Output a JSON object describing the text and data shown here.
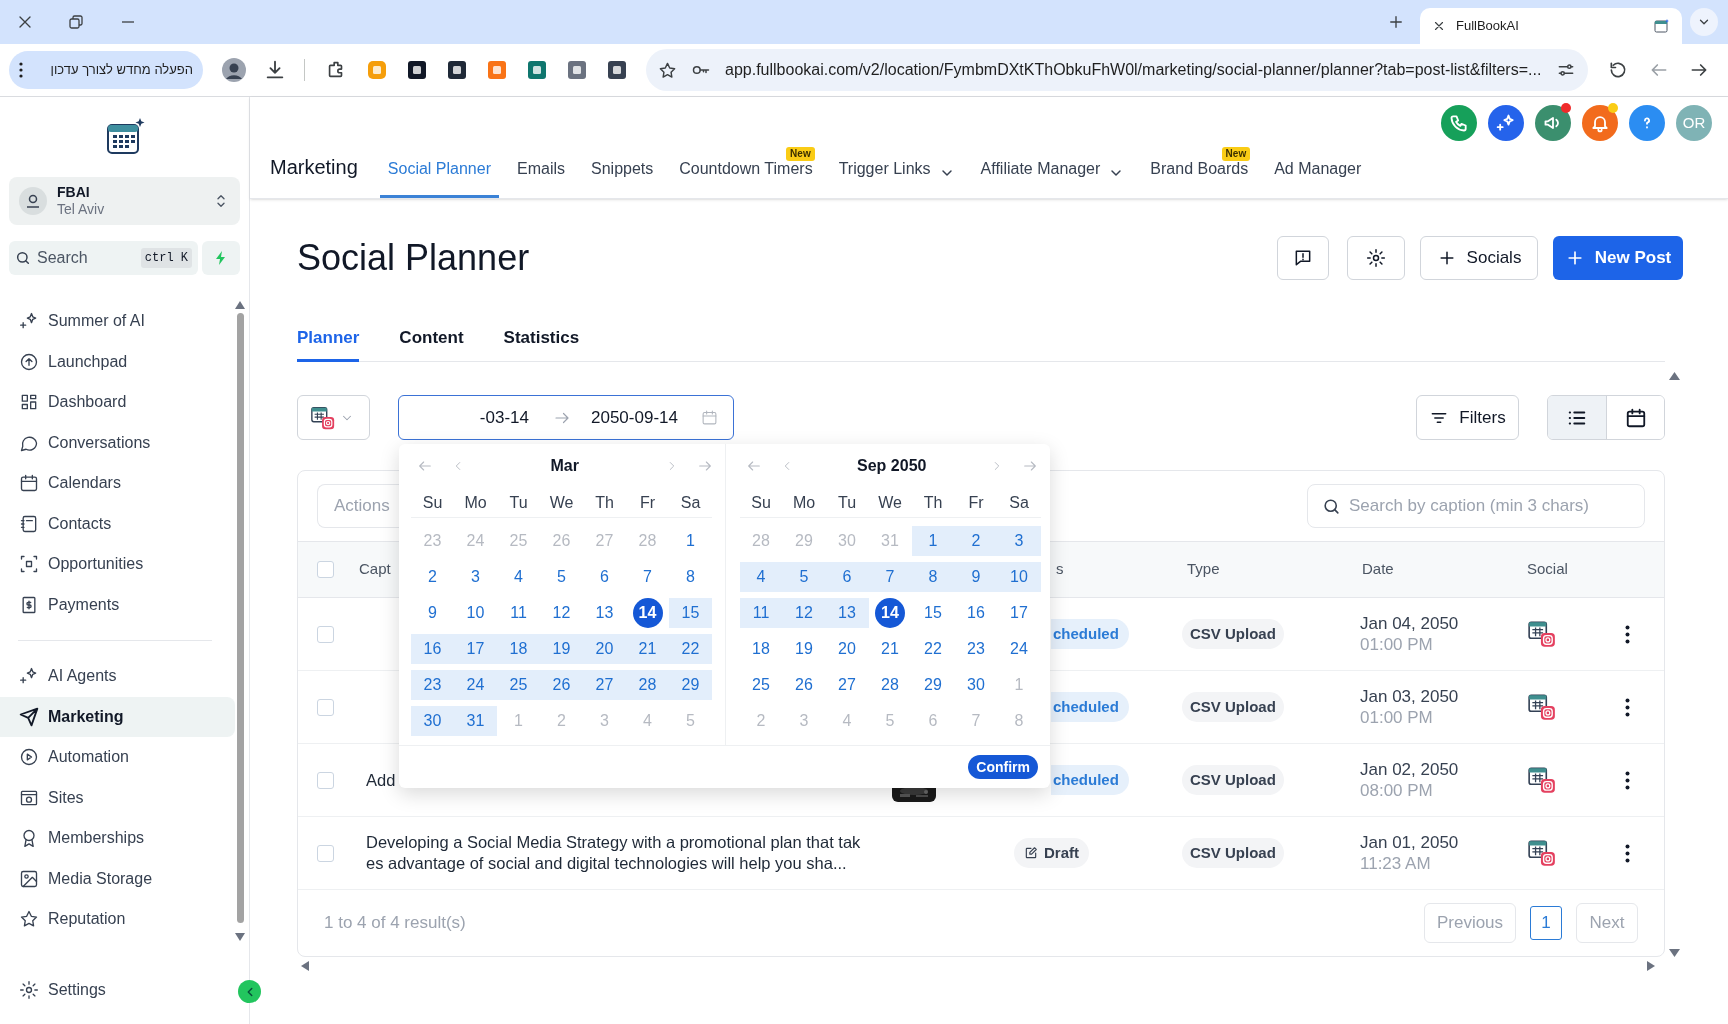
{
  "browser": {
    "tab_title": "FullBookAI",
    "update_button": "הפעלה מחדש לצורך עדכון",
    "url": "app.fullbookai.com/v2/location/FymbmDXtKThObkuFhW0l/marketing/social-planner/planner?tab=post-list&filters=..."
  },
  "sidebar": {
    "account": {
      "name": "FBAI",
      "location": "Tel Aviv"
    },
    "search": {
      "placeholder": "Search",
      "shortcut": "ctrl K"
    },
    "sections": [
      {
        "items": [
          {
            "label": "Summer of AI",
            "selected": false
          },
          {
            "label": "Launchpad",
            "selected": false
          },
          {
            "label": "Dashboard",
            "selected": false
          },
          {
            "label": "Conversations",
            "selected": false
          },
          {
            "label": "Calendars",
            "selected": false
          },
          {
            "label": "Contacts",
            "selected": false
          },
          {
            "label": "Opportunities",
            "selected": false
          },
          {
            "label": "Payments",
            "selected": false
          }
        ]
      },
      {
        "items": [
          {
            "label": "AI Agents",
            "selected": false
          },
          {
            "label": "Marketing",
            "selected": true
          },
          {
            "label": "Automation",
            "selected": false
          },
          {
            "label": "Sites",
            "selected": false
          },
          {
            "label": "Memberships",
            "selected": false
          },
          {
            "label": "Media Storage",
            "selected": false
          },
          {
            "label": "Reputation",
            "selected": false
          }
        ]
      }
    ],
    "settings": "Settings"
  },
  "header": {
    "title": "Marketing",
    "avatar": "OR",
    "nav": [
      {
        "label": "Social Planner",
        "selected": true,
        "dropdown": false
      },
      {
        "label": "Emails",
        "selected": false,
        "dropdown": false
      },
      {
        "label": "Snippets",
        "selected": false,
        "dropdown": false
      },
      {
        "label": "Countdown Timers",
        "selected": false,
        "dropdown": false,
        "badge": "New"
      },
      {
        "label": "Trigger Links",
        "selected": false,
        "dropdown": true
      },
      {
        "label": "Affiliate Manager",
        "selected": false,
        "dropdown": true
      },
      {
        "label": "Brand Boards",
        "selected": false,
        "dropdown": false,
        "badge": "New"
      },
      {
        "label": "Ad Manager",
        "selected": false,
        "dropdown": false
      }
    ]
  },
  "page": {
    "title": "Social Planner",
    "socials_button": "Socials",
    "new_post_button": "New Post",
    "tabs": [
      {
        "label": "Planner",
        "selected": true
      },
      {
        "label": "Content",
        "selected": false
      },
      {
        "label": "Statistics",
        "selected": false
      }
    ]
  },
  "filters": {
    "start_date": "-03-14",
    "end_date": "2050-09-14",
    "filters_button": "Filters",
    "views": [
      {
        "selected": true
      },
      {
        "selected": false
      }
    ]
  },
  "date_picker": {
    "confirm": "Confirm",
    "months": [
      {
        "title": "Mar",
        "weekdays": [
          "Su",
          "Mo",
          "Tu",
          "We",
          "Th",
          "Fr",
          "Sa"
        ],
        "weeks": [
          [
            {
              "t": "23",
              "muted": true,
              "in_range": false,
              "selected": false
            },
            {
              "t": "24",
              "muted": true,
              "in_range": false,
              "selected": false
            },
            {
              "t": "25",
              "muted": true,
              "in_range": false,
              "selected": false
            },
            {
              "t": "26",
              "muted": true,
              "in_range": false,
              "selected": false
            },
            {
              "t": "27",
              "muted": true,
              "in_range": false,
              "selected": false
            },
            {
              "t": "28",
              "muted": true,
              "in_range": false,
              "selected": false
            },
            {
              "t": "1",
              "muted": false,
              "in_range": false,
              "selected": false
            }
          ],
          [
            {
              "t": "2",
              "muted": false,
              "in_range": false,
              "selected": false
            },
            {
              "t": "3",
              "muted": false,
              "in_range": false,
              "selected": false
            },
            {
              "t": "4",
              "muted": false,
              "in_range": false,
              "selected": false
            },
            {
              "t": "5",
              "muted": false,
              "in_range": false,
              "selected": false
            },
            {
              "t": "6",
              "muted": false,
              "in_range": false,
              "selected": false
            },
            {
              "t": "7",
              "muted": false,
              "in_range": false,
              "selected": false
            },
            {
              "t": "8",
              "muted": false,
              "in_range": false,
              "selected": false
            }
          ],
          [
            {
              "t": "9",
              "muted": false,
              "in_range": false,
              "selected": false
            },
            {
              "t": "10",
              "muted": false,
              "in_range": false,
              "selected": false
            },
            {
              "t": "11",
              "muted": false,
              "in_range": false,
              "selected": false
            },
            {
              "t": "12",
              "muted": false,
              "in_range": false,
              "selected": false
            },
            {
              "t": "13",
              "muted": false,
              "in_range": false,
              "selected": false
            },
            {
              "t": "14",
              "muted": false,
              "in_range": false,
              "selected": true
            },
            {
              "t": "15",
              "muted": false,
              "in_range": true,
              "selected": false
            }
          ],
          [
            {
              "t": "16",
              "muted": false,
              "in_range": true,
              "selected": false
            },
            {
              "t": "17",
              "muted": false,
              "in_range": true,
              "selected": false
            },
            {
              "t": "18",
              "muted": false,
              "in_range": true,
              "selected": false
            },
            {
              "t": "19",
              "muted": false,
              "in_range": true,
              "selected": false
            },
            {
              "t": "20",
              "muted": false,
              "in_range": true,
              "selected": false
            },
            {
              "t": "21",
              "muted": false,
              "in_range": true,
              "selected": false
            },
            {
              "t": "22",
              "muted": false,
              "in_range": true,
              "selected": false
            }
          ],
          [
            {
              "t": "23",
              "muted": false,
              "in_range": true,
              "selected": false
            },
            {
              "t": "24",
              "muted": false,
              "in_range": true,
              "selected": false
            },
            {
              "t": "25",
              "muted": false,
              "in_range": true,
              "selected": false
            },
            {
              "t": "26",
              "muted": false,
              "in_range": true,
              "selected": false
            },
            {
              "t": "27",
              "muted": false,
              "in_range": true,
              "selected": false
            },
            {
              "t": "28",
              "muted": false,
              "in_range": true,
              "selected": false
            },
            {
              "t": "29",
              "muted": false,
              "in_range": true,
              "selected": false
            }
          ],
          [
            {
              "t": "30",
              "muted": false,
              "in_range": true,
              "selected": false
            },
            {
              "t": "31",
              "muted": false,
              "in_range": true,
              "selected": false
            },
            {
              "t": "1",
              "muted": true,
              "in_range": false,
              "selected": false
            },
            {
              "t": "2",
              "muted": true,
              "in_range": false,
              "selected": false
            },
            {
              "t": "3",
              "muted": true,
              "in_range": false,
              "selected": false
            },
            {
              "t": "4",
              "muted": true,
              "in_range": false,
              "selected": false
            },
            {
              "t": "5",
              "muted": true,
              "in_range": false,
              "selected": false
            }
          ]
        ]
      },
      {
        "title": "Sep 2050",
        "weekdays": [
          "Su",
          "Mo",
          "Tu",
          "We",
          "Th",
          "Fr",
          "Sa"
        ],
        "weeks": [
          [
            {
              "t": "28",
              "muted": true,
              "in_range": false,
              "selected": false
            },
            {
              "t": "29",
              "muted": true,
              "in_range": false,
              "selected": false
            },
            {
              "t": "30",
              "muted": true,
              "in_range": false,
              "selected": false
            },
            {
              "t": "31",
              "muted": true,
              "in_range": false,
              "selected": false
            },
            {
              "t": "1",
              "muted": false,
              "in_range": true,
              "selected": false
            },
            {
              "t": "2",
              "muted": false,
              "in_range": true,
              "selected": false
            },
            {
              "t": "3",
              "muted": false,
              "in_range": true,
              "selected": false
            }
          ],
          [
            {
              "t": "4",
              "muted": false,
              "in_range": true,
              "selected": false
            },
            {
              "t": "5",
              "muted": false,
              "in_range": true,
              "selected": false
            },
            {
              "t": "6",
              "muted": false,
              "in_range": true,
              "selected": false
            },
            {
              "t": "7",
              "muted": false,
              "in_range": true,
              "selected": false
            },
            {
              "t": "8",
              "muted": false,
              "in_range": true,
              "selected": false
            },
            {
              "t": "9",
              "muted": false,
              "in_range": true,
              "selected": false
            },
            {
              "t": "10",
              "muted": false,
              "in_range": true,
              "selected": false
            }
          ],
          [
            {
              "t": "11",
              "muted": false,
              "in_range": true,
              "selected": false
            },
            {
              "t": "12",
              "muted": false,
              "in_range": true,
              "selected": false
            },
            {
              "t": "13",
              "muted": false,
              "in_range": true,
              "selected": false
            },
            {
              "t": "14",
              "muted": false,
              "in_range": false,
              "selected": true
            },
            {
              "t": "15",
              "muted": false,
              "in_range": false,
              "selected": false
            },
            {
              "t": "16",
              "muted": false,
              "in_range": false,
              "selected": false
            },
            {
              "t": "17",
              "muted": false,
              "in_range": false,
              "selected": false
            }
          ],
          [
            {
              "t": "18",
              "muted": false,
              "in_range": false,
              "selected": false
            },
            {
              "t": "19",
              "muted": false,
              "in_range": false,
              "selected": false
            },
            {
              "t": "20",
              "muted": false,
              "in_range": false,
              "selected": false
            },
            {
              "t": "21",
              "muted": false,
              "in_range": false,
              "selected": false
            },
            {
              "t": "22",
              "muted": false,
              "in_range": false,
              "selected": false
            },
            {
              "t": "23",
              "muted": false,
              "in_range": false,
              "selected": false
            },
            {
              "t": "24",
              "muted": false,
              "in_range": false,
              "selected": false
            }
          ],
          [
            {
              "t": "25",
              "muted": false,
              "in_range": false,
              "selected": false
            },
            {
              "t": "26",
              "muted": false,
              "in_range": false,
              "selected": false
            },
            {
              "t": "27",
              "muted": false,
              "in_range": false,
              "selected": false
            },
            {
              "t": "28",
              "muted": false,
              "in_range": false,
              "selected": false
            },
            {
              "t": "29",
              "muted": false,
              "in_range": false,
              "selected": false
            },
            {
              "t": "30",
              "muted": false,
              "in_range": false,
              "selected": false
            },
            {
              "t": "1",
              "muted": true,
              "in_range": false,
              "selected": false
            }
          ],
          [
            {
              "t": "2",
              "muted": true,
              "in_range": false,
              "selected": false
            },
            {
              "t": "3",
              "muted": true,
              "in_range": false,
              "selected": false
            },
            {
              "t": "4",
              "muted": true,
              "in_range": false,
              "selected": false
            },
            {
              "t": "5",
              "muted": true,
              "in_range": false,
              "selected": false
            },
            {
              "t": "6",
              "muted": true,
              "in_range": false,
              "selected": false
            },
            {
              "t": "7",
              "muted": true,
              "in_range": false,
              "selected": false
            },
            {
              "t": "8",
              "muted": true,
              "in_range": false,
              "selected": false
            }
          ]
        ]
      }
    ]
  },
  "table": {
    "actions": "Actions",
    "search_placeholder": "Search by caption (min 3 chars)",
    "header_checked": false,
    "columns": [
      "Capt",
      "s",
      "Type",
      "Date",
      "Social"
    ],
    "rows": [
      {
        "checked": false,
        "status": {
          "text": "cheduled",
          "kind": "scheduled"
        },
        "type": "CSV Upload",
        "date": "Jan 04, 2050",
        "time": "01:00 PM"
      },
      {
        "checked": false,
        "status": {
          "text": "cheduled",
          "kind": "scheduled"
        },
        "type": "CSV Upload",
        "date": "Jan 03, 2050",
        "time": "01:00 PM"
      },
      {
        "checked": false,
        "caption": "Add",
        "thumbnail": true,
        "status": {
          "text": "cheduled",
          "kind": "scheduled"
        },
        "type": "CSV Upload",
        "date": "Jan 02, 2050",
        "time": "08:00 PM"
      },
      {
        "checked": false,
        "caption": "Developing a Social Media Strategy with a promotional plan that takes advantage of social and digital technologies will help you sha...",
        "status": {
          "text": "Draft",
          "kind": "draft"
        },
        "type": "CSV Upload",
        "date": "Jan 01, 2050",
        "time": "11:23 AM"
      }
    ],
    "summary": "1 to 4 of 4 result(s)",
    "previous": "Previous",
    "next": "Next",
    "pages": [
      {
        "label": "1",
        "selected": true
      }
    ]
  }
}
